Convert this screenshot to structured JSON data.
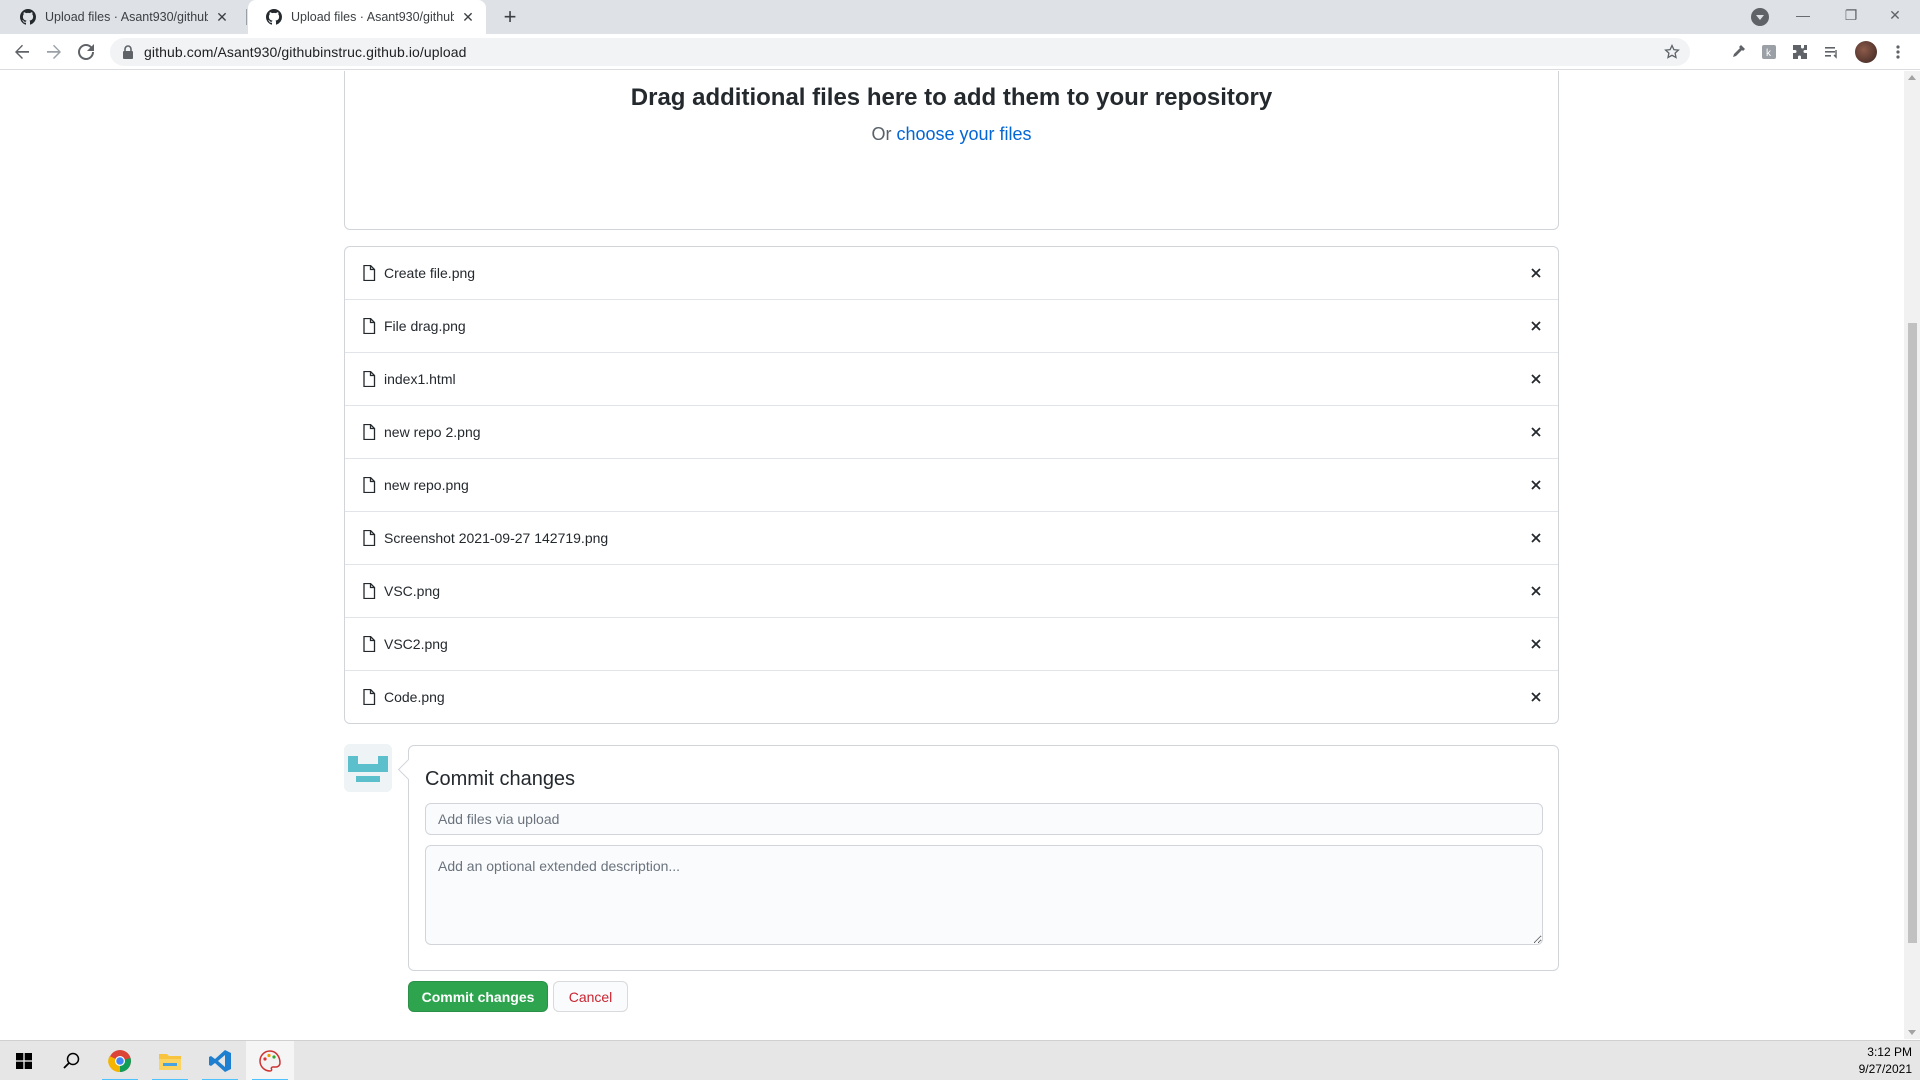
{
  "browser": {
    "tabs": [
      {
        "title": "Upload files · Asant930/githubinstruc.github.io",
        "active": false
      },
      {
        "title": "Upload files · Asant930/githubinstruc.github.io",
        "active": true
      }
    ],
    "url": "github.com/Asant930/githubinstruc.github.io/upload"
  },
  "dropzone": {
    "heading": "Drag additional files here to add them to your repository",
    "prefix": "Or",
    "link": "choose your files"
  },
  "files": [
    {
      "name": "Create file.png"
    },
    {
      "name": "File drag.png"
    },
    {
      "name": "index1.html"
    },
    {
      "name": "new repo 2.png"
    },
    {
      "name": "new repo.png"
    },
    {
      "name": "Screenshot 2021-09-27 142719.png"
    },
    {
      "name": "VSC.png"
    },
    {
      "name": "VSC2.png"
    },
    {
      "name": "Code.png"
    }
  ],
  "commit": {
    "title": "Commit changes",
    "summary_placeholder": "Add files via upload",
    "description_placeholder": "Add an optional extended description...",
    "commit_button": "Commit changes",
    "cancel_button": "Cancel"
  },
  "taskbar": {
    "time": "3:12 PM",
    "date": "9/27/2021"
  },
  "colors": {
    "primary_green": "#2ea44f",
    "link_blue": "#0366d6",
    "cancel_red": "#cb2431"
  }
}
